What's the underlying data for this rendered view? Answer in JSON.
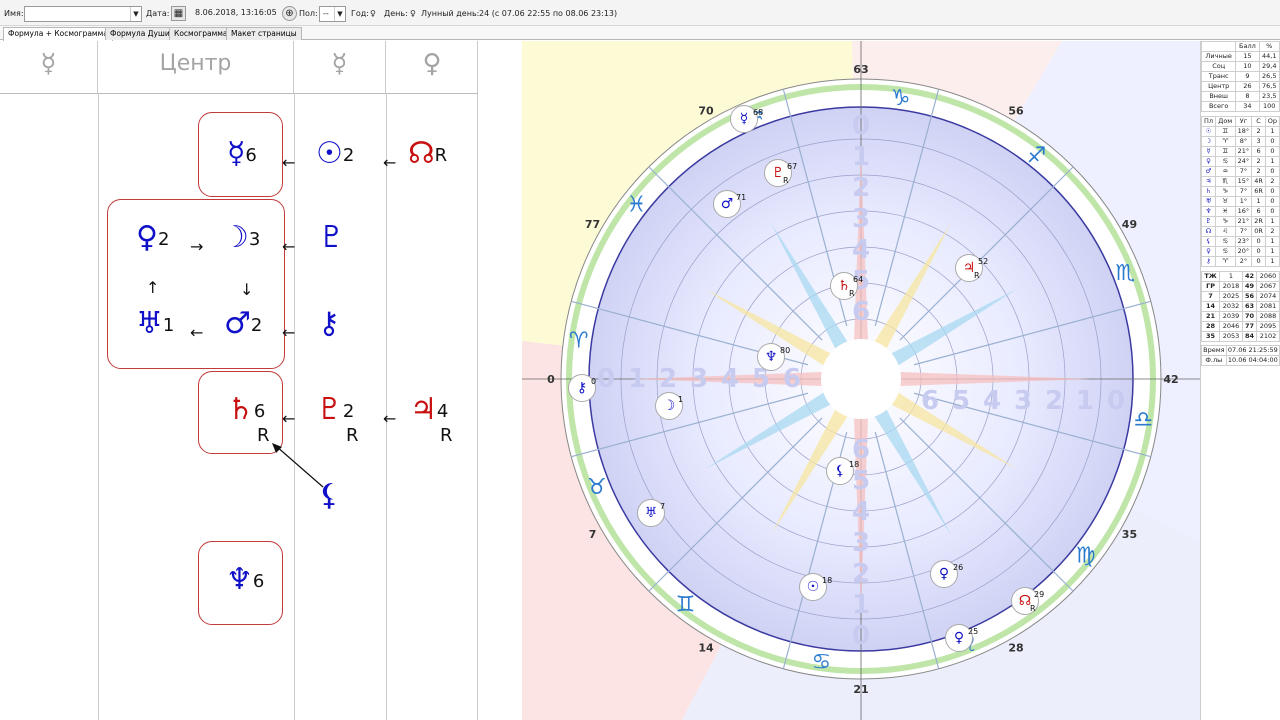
{
  "toolbar": {
    "name_label": "Имя:",
    "name_value": "",
    "date_label": "Дата:",
    "date_value": "8.06.2018, 13:16:05",
    "gender_label": "Пол:",
    "gender_value": "--",
    "year_label": "Год:",
    "year_icon": "♀",
    "day_label": "День:",
    "day_icon": "♀",
    "lunar_day_label": "Лунный день:",
    "lunar_day_value": "24 (с 07.06 22:55 по 08.06 23:13)"
  },
  "tabs": [
    "Формула + Космограмма",
    "Формула Души",
    "Космограмма",
    "Макет страницы"
  ],
  "formula": {
    "headers": [
      "☿",
      "Центр",
      "☿",
      "♀"
    ],
    "glyphs": {
      "mercury6": {
        "sym": "☿",
        "num": "6"
      },
      "sun2": {
        "sym": "☉",
        "num": "2"
      },
      "node": {
        "sym": "☊",
        "num": "R"
      },
      "venus2": {
        "sym": "♀",
        "num": "2"
      },
      "moon3": {
        "sym": "☽",
        "num": "3"
      },
      "pluto_c3": {
        "sym": "♇",
        "num": ""
      },
      "uranus1": {
        "sym": "♅",
        "num": "1"
      },
      "mars2": {
        "sym": "♂",
        "num": "2"
      },
      "chiron_c3": {
        "sym": "⚷",
        "num": ""
      },
      "saturn6": {
        "sym": "♄",
        "num": "6",
        "r": "R"
      },
      "pluto2": {
        "sym": "♇",
        "num": "2",
        "r": "R"
      },
      "jupiter4": {
        "sym": "♃",
        "num": "4",
        "r": "R"
      },
      "lilith": {
        "sym": "⚸",
        "num": ""
      },
      "neptune6": {
        "sym": "♆",
        "num": "6"
      }
    }
  },
  "chart": {
    "outer_numbers": [
      "63",
      "56",
      "49",
      "42",
      "35",
      "28",
      "21",
      "14",
      "7",
      "0",
      "77",
      "70"
    ],
    "zodiac": [
      "♑",
      "♐",
      "♏",
      "♎",
      "♍",
      "♌",
      "♋",
      "♊",
      "♉",
      "♈",
      "♓",
      "♒"
    ],
    "planets": [
      {
        "sym": "☿",
        "deg": "68",
        "r": "",
        "c": "blue"
      },
      {
        "sym": "♇",
        "deg": "67",
        "r": "R",
        "c": "red"
      },
      {
        "sym": "♂",
        "deg": "71",
        "r": "",
        "c": "blue"
      },
      {
        "sym": "♄",
        "deg": "64",
        "r": "R",
        "c": "red"
      },
      {
        "sym": "♃",
        "deg": "52",
        "r": "R",
        "c": "red"
      },
      {
        "sym": "♆",
        "deg": "80",
        "r": "",
        "c": "blue"
      },
      {
        "sym": "⚷",
        "deg": "0",
        "r": "",
        "c": "blue"
      },
      {
        "sym": "☽",
        "deg": "1",
        "r": "",
        "c": "blue"
      },
      {
        "sym": "⚸",
        "deg": "18",
        "r": "",
        "c": "blue"
      },
      {
        "sym": "♅",
        "deg": "7",
        "r": "",
        "c": "blue"
      },
      {
        "sym": "☉",
        "deg": "18",
        "r": "",
        "c": "blue"
      },
      {
        "sym": "♀",
        "deg": "26",
        "r": "",
        "c": "blue"
      },
      {
        "sym": "☊",
        "deg": "29",
        "r": "R",
        "c": "red"
      },
      {
        "sym": "♀",
        "deg": "25",
        "r": "",
        "c": "blue"
      }
    ],
    "inner_scale": [
      "0",
      "1",
      "2",
      "3",
      "4",
      "5",
      "6"
    ]
  },
  "side": {
    "score_header": [
      "",
      "Балл",
      "%"
    ],
    "scores": [
      [
        "Личные",
        "15",
        "44,1"
      ],
      [
        "Соц",
        "10",
        "29,4"
      ],
      [
        "Транс",
        "9",
        "26,5"
      ],
      [
        "Центр",
        "26",
        "76,5"
      ],
      [
        "Внеш",
        "8",
        "23,5"
      ],
      [
        "Всего",
        "34",
        "100"
      ]
    ],
    "planet_header": [
      "Пл",
      "Дом",
      "Уг",
      "С",
      "Ор"
    ],
    "planets": [
      [
        "☉",
        "♊",
        "18°",
        "2",
        "1"
      ],
      [
        "☽",
        "♈",
        "8°",
        "3",
        "0"
      ],
      [
        "☿",
        "♊",
        "21°",
        "6",
        "0"
      ],
      [
        "♀",
        "♋",
        "24°",
        "2",
        "1"
      ],
      [
        "♂",
        "♒",
        "7°",
        "2",
        "0"
      ],
      [
        "♃",
        "♏",
        "15°",
        "4R",
        "2"
      ],
      [
        "♄",
        "♑",
        "7°",
        "6R",
        "0"
      ],
      [
        "♅",
        "♉",
        "1°",
        "1",
        "0"
      ],
      [
        "♆",
        "♓",
        "16°",
        "6",
        "0"
      ],
      [
        "♇",
        "♑",
        "21°",
        "2R",
        "1"
      ],
      [
        "☊",
        "♌",
        "7°",
        "0R",
        "2"
      ],
      [
        "⚸",
        "♋",
        "23°",
        "0",
        "1"
      ],
      [
        "♀",
        "♋",
        "20°",
        "0",
        "1"
      ],
      [
        "⚷",
        "♈",
        "2°",
        "0",
        "1"
      ]
    ],
    "years": [
      [
        "ТЖ",
        "1",
        "42",
        "2060"
      ],
      [
        "ГР",
        "2018",
        "49",
        "2067"
      ],
      [
        "7",
        "2025",
        "56",
        "2074"
      ],
      [
        "14",
        "2032",
        "63",
        "2081"
      ],
      [
        "21",
        "2039",
        "70",
        "2088"
      ],
      [
        "28",
        "2046",
        "77",
        "2095"
      ],
      [
        "35",
        "2053",
        "84",
        "2102"
      ]
    ],
    "time_label": "Время",
    "time_value": "07.06 21:25:59",
    "phase_label": "Ф.лы",
    "phase_value": "10.06 04:04:00"
  },
  "colors": {
    "blue": "#1010c8",
    "red": "#c81010",
    "box_border": "#c23a3a"
  }
}
